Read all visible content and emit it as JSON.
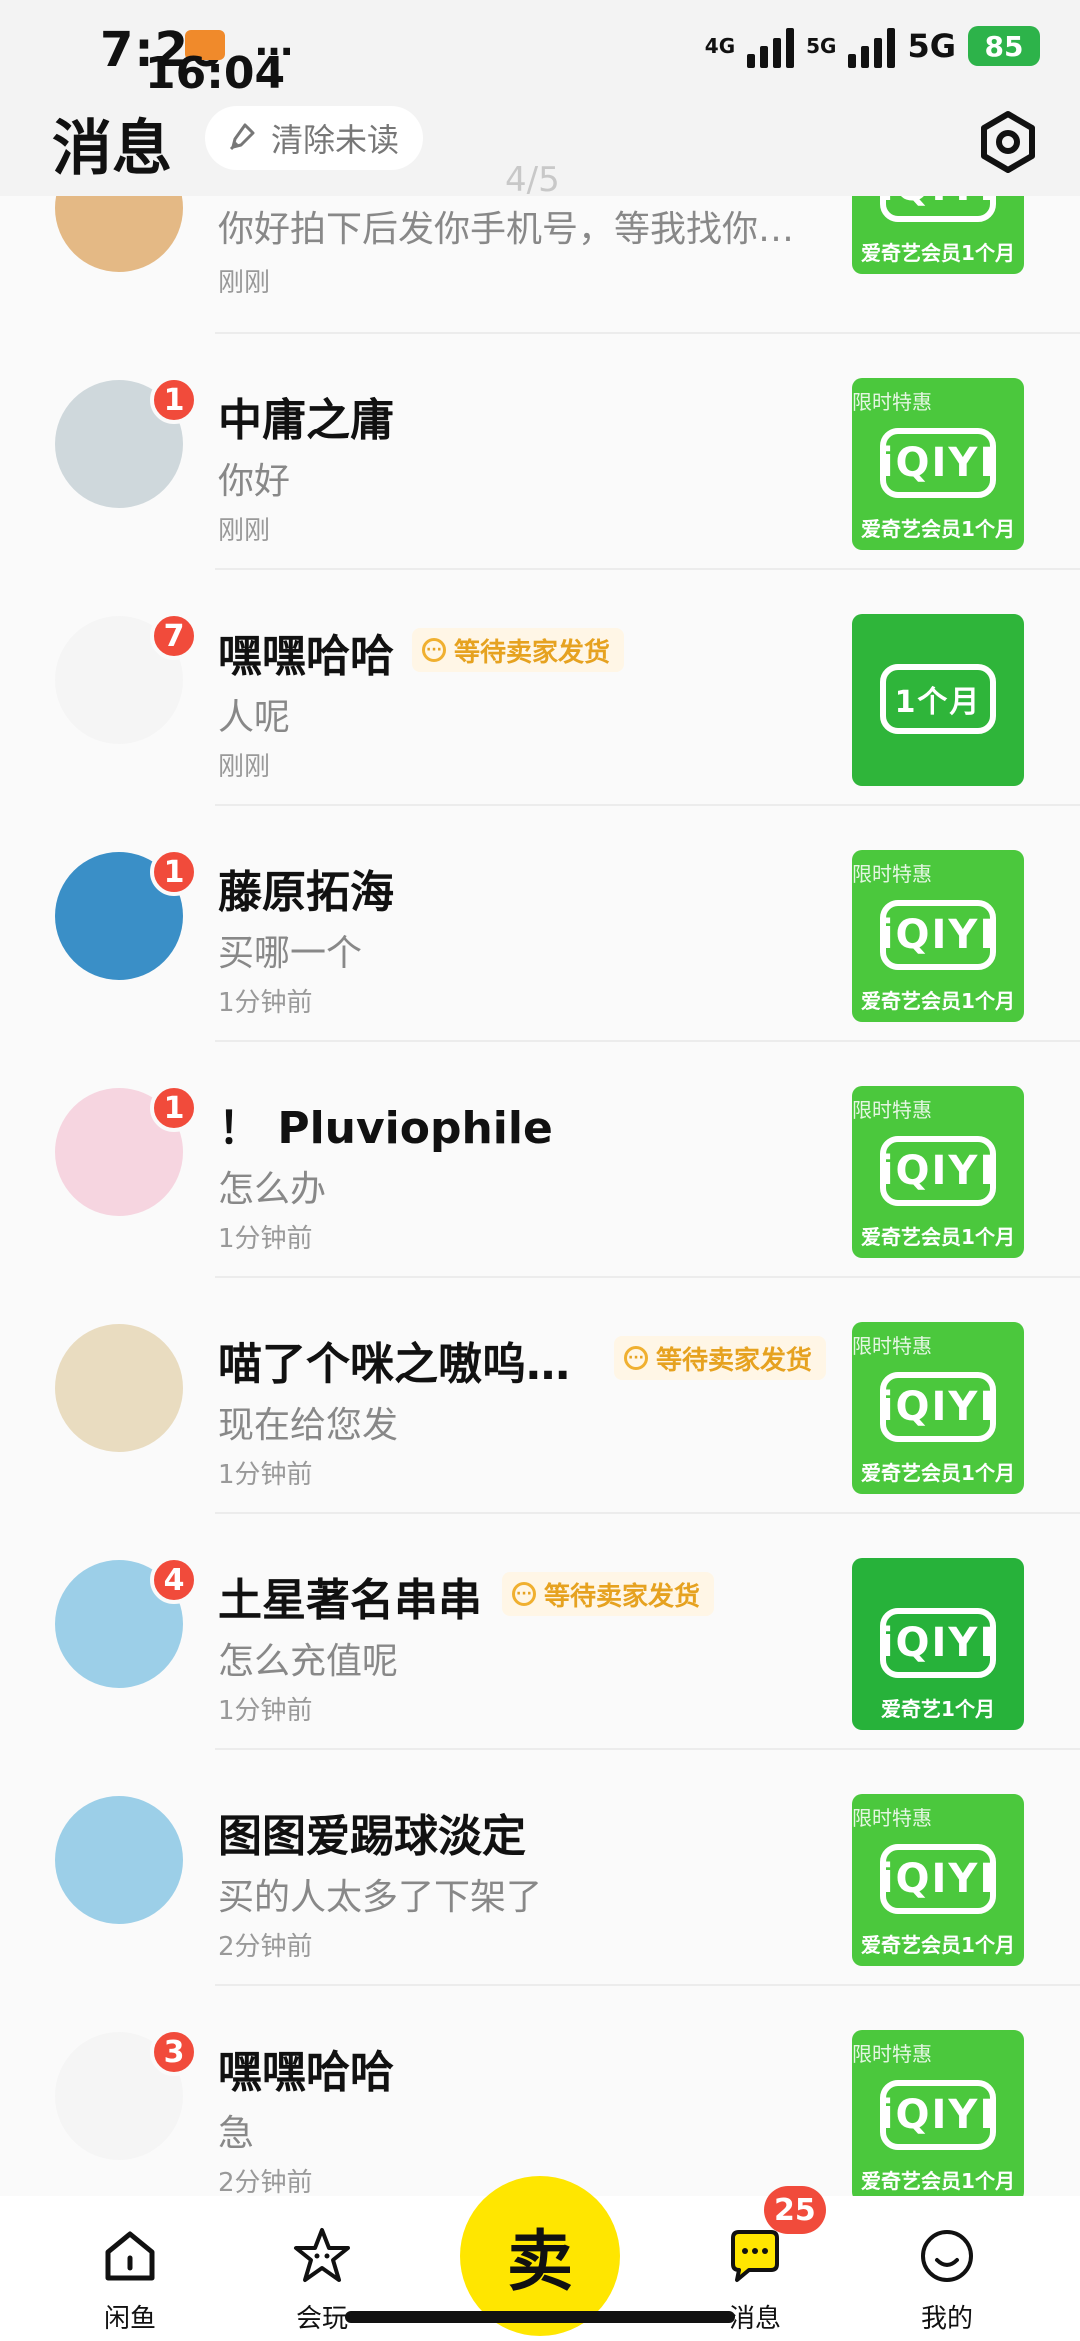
{
  "status_bar": {
    "time_back": "7:26",
    "time_front": "16:04",
    "dots": "…",
    "net1": "4G",
    "net2": "5G",
    "net3": "5G",
    "battery": "85"
  },
  "header": {
    "title": "消息",
    "clear_label": "清除未读",
    "page_indicator": "4/5"
  },
  "conversations": [
    {
      "name": "",
      "message": "你好拍下后发你手机号，等我找你…",
      "time": "刚刚",
      "badge": "",
      "tag": "",
      "thumb_promo": "",
      "thumb_logo": "iQIYI",
      "thumb_caption": "爱奇艺会员1个月"
    },
    {
      "name": "中庸之庸",
      "message": "你好",
      "time": "刚刚",
      "badge": "1",
      "tag": "",
      "thumb_promo": "限时特惠",
      "thumb_logo": "iQIYI",
      "thumb_caption": "爱奇艺会员1个月"
    },
    {
      "name": "嘿嘿哈哈",
      "message": "人呢",
      "time": "刚刚",
      "badge": "7",
      "tag": "等待卖家发货",
      "thumb_promo": "",
      "thumb_logo": "1个月",
      "thumb_caption": ""
    },
    {
      "name": "藤原拓海",
      "message": "买哪一个",
      "time": "1分钟前",
      "badge": "1",
      "tag": "",
      "thumb_promo": "限时特惠",
      "thumb_logo": "iQIYI",
      "thumb_caption": "爱奇艺会员1个月"
    },
    {
      "name": "！ Pluviophile",
      "message": "怎么办",
      "time": "1分钟前",
      "badge": "1",
      "tag": "",
      "thumb_promo": "限时特惠",
      "thumb_logo": "iQIYI",
      "thumb_caption": "爱奇艺会员1个月"
    },
    {
      "name": "喵了个咪之嗷呜…",
      "message": "现在给您发",
      "time": "1分钟前",
      "badge": "",
      "tag": "等待卖家发货",
      "thumb_promo": "限时特惠",
      "thumb_logo": "iQIYI",
      "thumb_caption": "爱奇艺会员1个月"
    },
    {
      "name": "土星著名串串",
      "message": "怎么充值呢",
      "time": "1分钟前",
      "badge": "4",
      "tag": "等待卖家发货",
      "thumb_promo": "",
      "thumb_logo": "iQIYI",
      "thumb_caption": "爱奇艺1个月"
    },
    {
      "name": "图图爱踢球淡定",
      "message": "买的人太多了下架了",
      "time": "2分钟前",
      "badge": "",
      "tag": "",
      "thumb_promo": "限时特惠",
      "thumb_logo": "iQIYI",
      "thumb_caption": "爱奇艺会员1个月"
    },
    {
      "name": "嘿嘿哈哈",
      "message": "急",
      "time": "2分钟前",
      "badge": "3",
      "tag": "",
      "thumb_promo": "限时特惠",
      "thumb_logo": "iQIYI",
      "thumb_caption": "爱奇艺会员1个月"
    }
  ],
  "tabbar": {
    "home": "闲鱼",
    "fun": "会玩",
    "sell": "卖",
    "messages": "消息",
    "messages_badge": "25",
    "mine": "我的"
  },
  "colors": {
    "brand_yellow": "#ffe600",
    "badge_red": "#f14b3b",
    "tag_orange": "#e6a220",
    "iqiyi_green": "#4bc83d"
  }
}
